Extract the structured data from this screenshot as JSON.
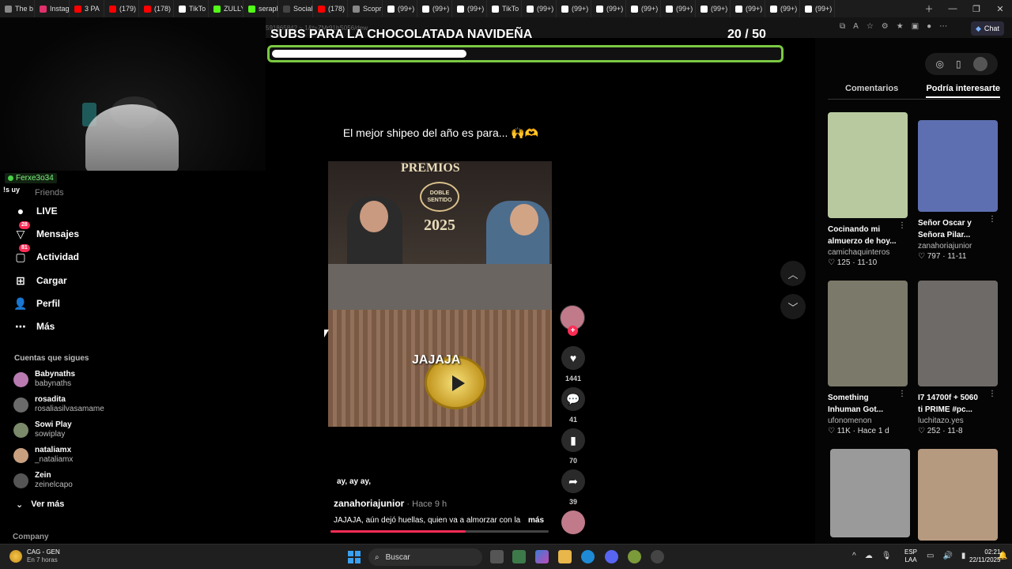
{
  "browser": {
    "tabs": [
      {
        "label": "The b",
        "color": "#888888"
      },
      {
        "label": "Instag",
        "color": "#e1306c"
      },
      {
        "label": "3 PA",
        "color": "#ff0000"
      },
      {
        "label": "(179)",
        "color": "#ff0000"
      },
      {
        "label": "(178)",
        "color": "#ff0000"
      },
      {
        "label": "TikTo",
        "color": "#ffffff"
      },
      {
        "label": "ZULLY",
        "color": "#53fc18"
      },
      {
        "label": "serapl",
        "color": "#53fc18"
      },
      {
        "label": "Social",
        "color": "#444444"
      },
      {
        "label": "(178)",
        "color": "#ff0000"
      },
      {
        "label": "Scopr",
        "color": "#888888"
      },
      {
        "label": "(99+)",
        "color": "#ffffff"
      },
      {
        "label": "(99+)",
        "color": "#ffffff"
      },
      {
        "label": "(99+)",
        "color": "#ffffff"
      },
      {
        "label": "TikTo",
        "color": "#ffffff"
      },
      {
        "label": "(99+)",
        "color": "#ffffff"
      },
      {
        "label": "(99+)",
        "color": "#ffffff"
      },
      {
        "label": "(99+)",
        "color": "#ffffff"
      },
      {
        "label": "(99+)",
        "color": "#ffffff"
      },
      {
        "label": "(99+)",
        "color": "#ffffff"
      },
      {
        "label": "(99+)",
        "color": "#ffffff"
      },
      {
        "label": "(99+)",
        "color": "#ffffff"
      },
      {
        "label": "(99+)",
        "color": "#ffffff"
      },
      {
        "label": "(99+)",
        "color": "#ffffff"
      }
    ],
    "url_fragment": "591865842 ~ 1&t=ZMr91bS056/dew",
    "chat_label": "Chat"
  },
  "overlay": {
    "user_tag": "Ferxe3o34",
    "sys_text": "!s uy",
    "subs_title": "SUBS PARA LA CHOCOLATADA NAVIDEÑA",
    "subs_count": "20  / 50",
    "subs_current": 20,
    "subs_goal": 50
  },
  "sidebar": {
    "friends": "Friends",
    "nav": [
      {
        "label": "LIVE",
        "icon": "live-icon",
        "badge": ""
      },
      {
        "label": "Mensajes",
        "icon": "messages-icon",
        "badge": "28"
      },
      {
        "label": "Actividad",
        "icon": "activity-icon",
        "badge": "81"
      },
      {
        "label": "Cargar",
        "icon": "upload-icon",
        "badge": ""
      },
      {
        "label": "Perfil",
        "icon": "profile-icon",
        "badge": ""
      },
      {
        "label": "Más",
        "icon": "more-icon",
        "badge": ""
      }
    ],
    "following_title": "Cuentas que sigues",
    "following": [
      {
        "name": "Babynaths",
        "handle": "babynaths"
      },
      {
        "name": "rosadita",
        "handle": "rosaliasilvasamame"
      },
      {
        "name": "Sowi Play",
        "handle": "sowiplay"
      },
      {
        "name": "nataliamx",
        "handle": "_nataliamx"
      },
      {
        "name": "Zein",
        "handle": "zeinelcapo"
      }
    ],
    "see_more": "Ver más",
    "company": "Company"
  },
  "video": {
    "caption_top": "El mejor shipeo del año es para... 🙌🫶",
    "premios": "PREMIOS",
    "doble_sentido": "DOBLE SENTIDO",
    "year": "2025",
    "jaja": "JAJAJA",
    "sound": "ay, ay ay,",
    "author": "zanahoriajunior",
    "ago": " · Hace 9 h",
    "description": "JAJAJA, aún dejó huellas, quien va a almorzar con la",
    "more": "más",
    "progress": 0.62,
    "likes": "1441",
    "comments": "41",
    "saves": "70",
    "shares": "39"
  },
  "right_panel": {
    "tab_comments": "Comentarios",
    "tab_suggested": "Podría interesarte",
    "cards": [
      {
        "title1": "Cocinando mi",
        "title2": "almuerzo de hoy...",
        "user": "camichaquinteros",
        "likes": "125",
        "date": "11-10",
        "thumb_color": "#b8c9a0"
      },
      {
        "title1": "Señor Oscar y",
        "title2": "Señora Pilar...",
        "user": "zanahoriajunior",
        "likes": "797",
        "date": "11-11",
        "thumb_color": "#5d6fb0"
      },
      {
        "title1": "Something",
        "title2": "Inhuman Got...",
        "user": "ufonomenon",
        "likes": "11K",
        "date": "Hace 1 d",
        "thumb_color": "#7b7a6a"
      },
      {
        "title1": "I7 14700f + 5060",
        "title2": "ti PRIME #pc...",
        "user": "luchitazo.yes",
        "likes": "252",
        "date": "11-8",
        "thumb_color": "#6d6a68"
      },
      {
        "title1": "",
        "title2": "",
        "user": "",
        "likes": "",
        "date": "",
        "thumb_color": "#9a9a9a"
      },
      {
        "title1": "",
        "title2": "",
        "user": "",
        "likes": "",
        "date": "",
        "thumb_color": "#b59a80"
      }
    ]
  },
  "taskbar": {
    "weather_line1": "CAG - GEN",
    "weather_line2": "En 7 horas",
    "search_placeholder": "Buscar",
    "lang1": "ESP",
    "lang2": "LAA",
    "time": "02:21",
    "date": "22/11/2025"
  }
}
